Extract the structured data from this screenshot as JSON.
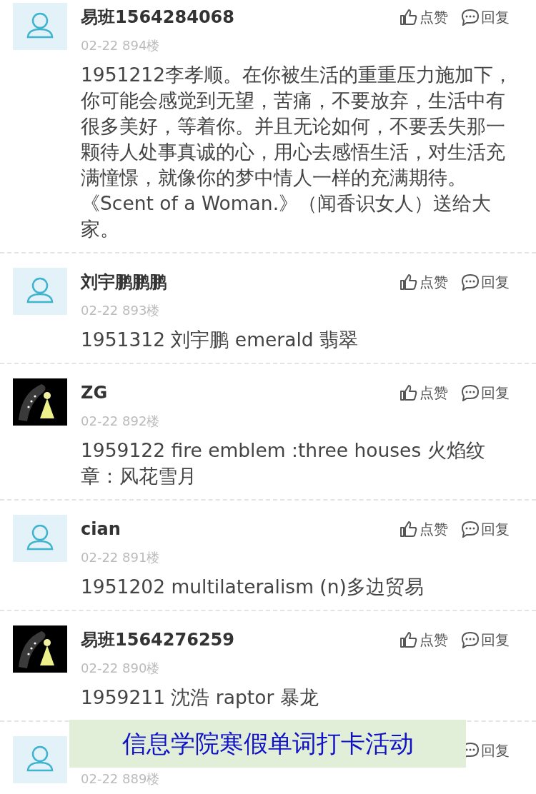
{
  "comments": [
    {
      "avatar": {
        "kind": "default"
      },
      "name": "易班1564284068",
      "meta": "02-22 894楼",
      "actions": [
        {
          "kind": "like",
          "label": "点赞"
        },
        {
          "kind": "reply",
          "label": "回复"
        }
      ],
      "body": "1951212李孝顺。在你被生活的重重压力施加下，你可能会感觉到无望，苦痛，不要放弃，生活中有很多美好，等着你。并且无论如何，不要丢失那一颗待人处事真诚的心，用心去感悟生活，对生活充满憧憬，就像你的梦中情人一样的充满期待。《Scent of a Woman.》（闻香识女人）送给大家。"
    },
    {
      "avatar": {
        "kind": "default"
      },
      "name": "刘宇鹏鹏鹏",
      "meta": "02-22 893楼",
      "actions": [
        {
          "kind": "like",
          "label": "点赞"
        },
        {
          "kind": "reply",
          "label": "回复"
        }
      ],
      "body": "1951312 刘宇鹏 emerald 翡翠"
    },
    {
      "name": "ZG",
      "meta": "02-22 892楼",
      "actions": [
        {
          "kind": "like",
          "label": "点赞"
        },
        {
          "kind": "reply",
          "label": "回复"
        }
      ],
      "body": "1959122 fire emblem :three houses 火焰纹章：风花雪月"
    },
    {
      "avatar": {
        "kind": "default"
      },
      "name": "cian",
      "meta": "02-22 891楼",
      "actions": [
        {
          "kind": "like",
          "label": "点赞"
        },
        {
          "kind": "reply",
          "label": "回复"
        }
      ],
      "body": "1951202 multilateralism (n)多边贸易"
    },
    {
      "name": "易班1564276259",
      "meta": "02-22 890楼",
      "actions": [
        {
          "kind": "like",
          "label": "点赞"
        },
        {
          "kind": "reply",
          "label": "回复"
        }
      ],
      "body": "1959211 沈浩 raptor 暴龙"
    },
    {
      "avatar": {
        "kind": "default"
      },
      "meta": "02-22 889楼",
      "actions": [
        {
          "kind": "reply",
          "label": "回复"
        }
      ]
    }
  ],
  "banner": {
    "text": "信息学院寒假单词打卡活动"
  }
}
